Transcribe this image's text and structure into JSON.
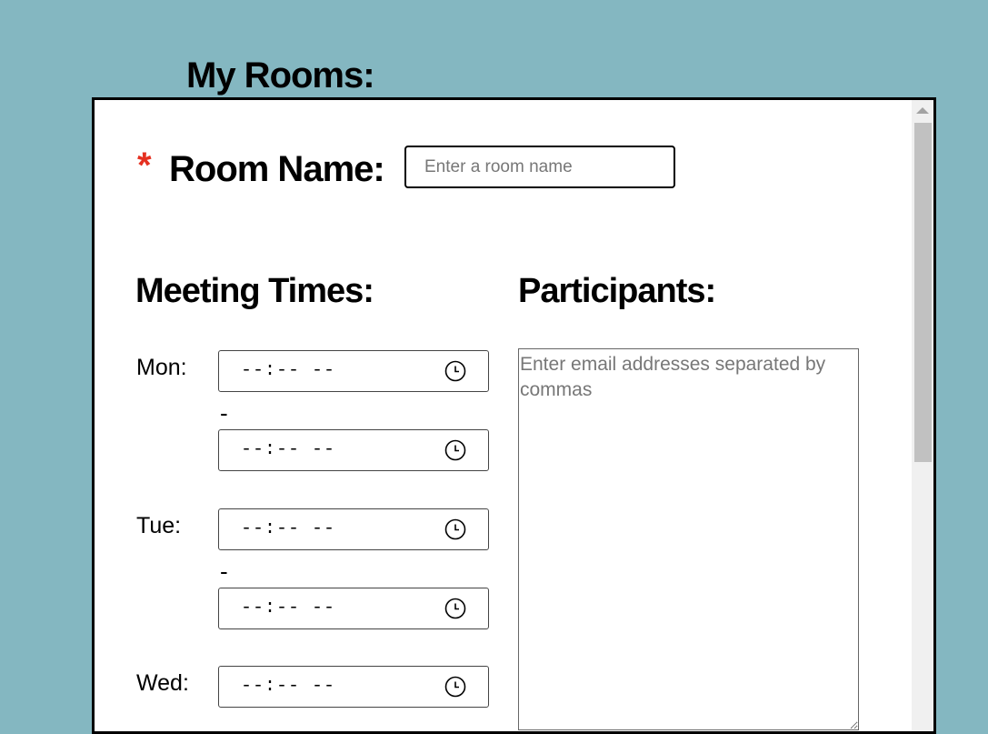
{
  "page": {
    "heading": "My Rooms:"
  },
  "form": {
    "required_marker": "*",
    "room_name_label": "Room Name:",
    "room_name_placeholder": "Enter a room name",
    "room_name_value": "",
    "meeting_times_heading": "Meeting Times:",
    "participants_heading": "Participants:",
    "participants_placeholder": "Enter email addresses separated by commas",
    "participants_value": "",
    "time_separator": "-",
    "days": [
      {
        "label": "Mon:",
        "start": "--:-- --",
        "end": "--:-- --"
      },
      {
        "label": "Tue:",
        "start": "--:-- --",
        "end": "--:-- --"
      },
      {
        "label": "Wed:",
        "start": "--:-- --"
      }
    ]
  },
  "colors": {
    "background": "#84b7c1",
    "required_marker": "#e53020",
    "panel": "#ffffff"
  },
  "icons": {
    "time_picker": "clock-icon"
  }
}
